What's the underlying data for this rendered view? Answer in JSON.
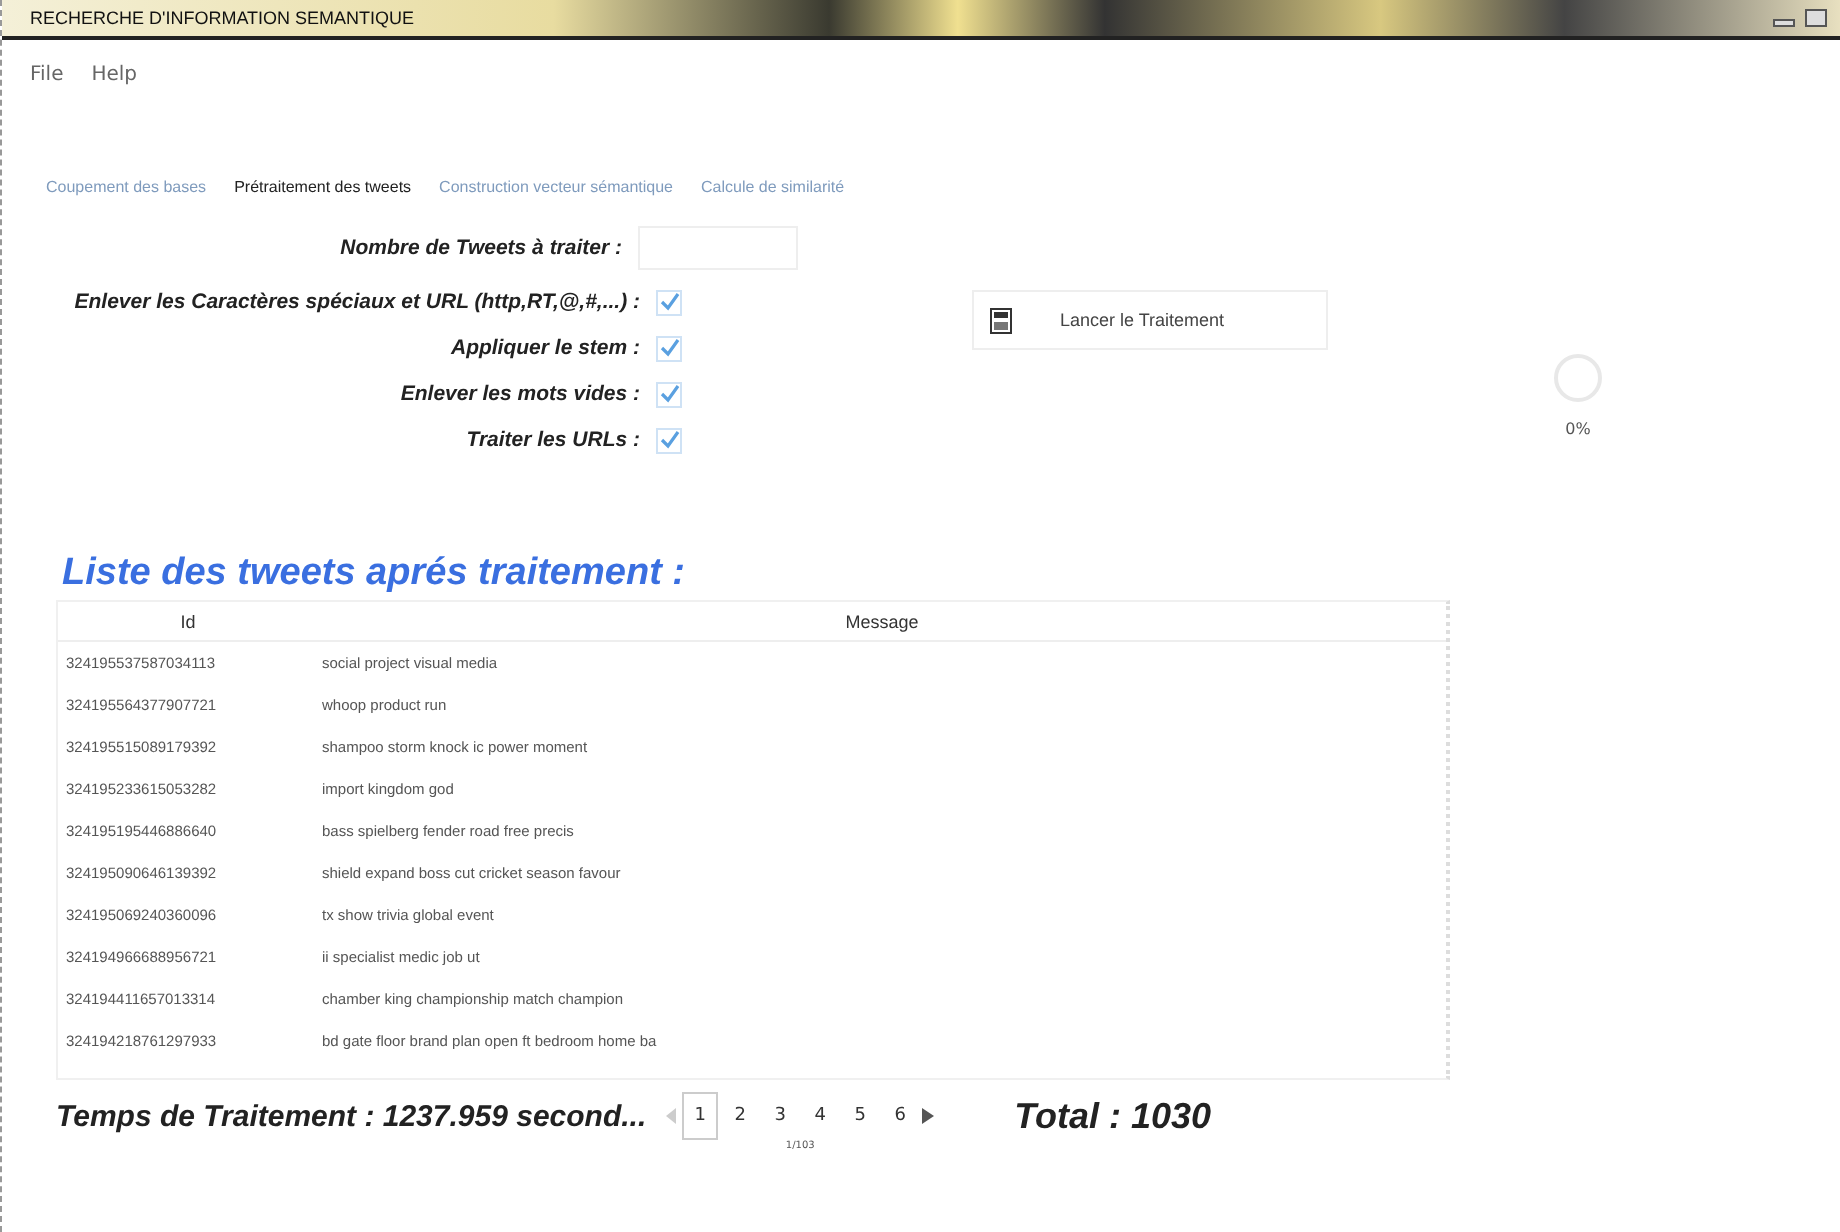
{
  "window": {
    "title": "RECHERCHE D'INFORMATION SEMANTIQUE"
  },
  "menu": [
    "File",
    "Help"
  ],
  "tabs": [
    {
      "label": "Coupement des bases",
      "selected": false
    },
    {
      "label": "Prétraitement des tweets",
      "selected": true
    },
    {
      "label": "Construction vecteur sémantique",
      "selected": false
    },
    {
      "label": "Calcule de similarité",
      "selected": false
    }
  ],
  "form": {
    "count_label": "Nombre de Tweets à traiter :",
    "options": [
      {
        "label": "Enlever les Caractères spéciaux et URL (http,RT,@,#,...) :",
        "checked": true
      },
      {
        "label": "Appliquer le stem :",
        "checked": true
      },
      {
        "label": "Enlever les mots vides :",
        "checked": true
      },
      {
        "label": "Traiter les URLs :",
        "checked": true
      }
    ]
  },
  "run_button": "Lancer le Traitement",
  "progress": {
    "level": 0,
    "reading": "0%"
  },
  "list_title": "Liste des tweets aprés traitement :",
  "table": {
    "columns": [
      "Id",
      "Message"
    ],
    "rows": [
      [
        "324195537587034113",
        "social project visual media"
      ],
      [
        "324195564377907721",
        "whoop product run"
      ],
      [
        "324195515089179392",
        "shampoo storm knock ic power moment"
      ],
      [
        "324195233615053282",
        "import kingdom god"
      ],
      [
        "324195195446886640",
        "bass spielberg fender road free precis"
      ],
      [
        "324195090646139392",
        "shield expand boss cut cricket season favour"
      ],
      [
        "324195069240360096",
        "tx show trivia global event"
      ],
      [
        "324194966688956721",
        "ii specialist medic job ut"
      ],
      [
        "324194411657013314",
        "chamber king championship match champion"
      ],
      [
        "324194218761297933",
        "bd gate floor brand plan open ft bedroom home ba"
      ]
    ]
  },
  "footer": {
    "time": "Temps de Traitement  : 1237.959 second...",
    "total": "Total : 1030",
    "pages": [
      {
        "label": "1",
        "selected": true
      },
      {
        "label": "2",
        "selected": false
      },
      {
        "label": "3",
        "selected": false
      },
      {
        "label": "4",
        "selected": false
      },
      {
        "label": "5",
        "selected": false
      },
      {
        "label": "6",
        "selected": false
      }
    ],
    "page_info": "1/103"
  }
}
